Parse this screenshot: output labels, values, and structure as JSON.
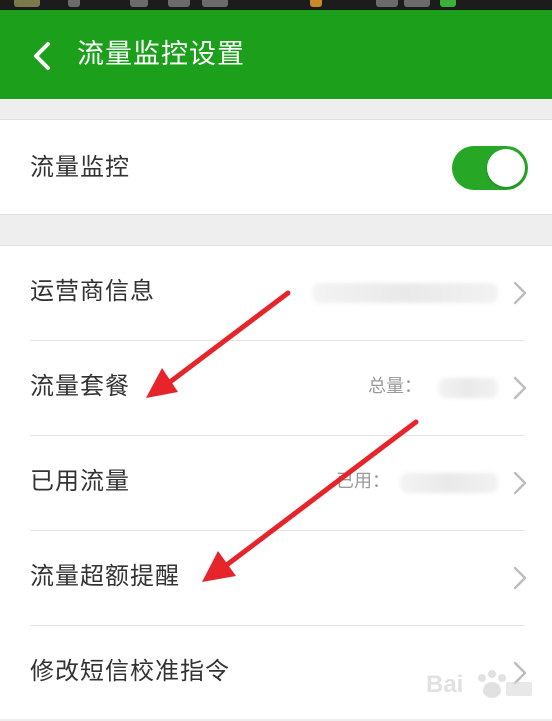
{
  "header": {
    "title": "流量监控设置"
  },
  "monitor": {
    "label": "流量监控",
    "enabled": true
  },
  "settings": {
    "items": [
      {
        "label": "运营商信息",
        "value": ""
      },
      {
        "label": "流量套餐",
        "value": "总量："
      },
      {
        "label": "已用流量",
        "value": "已用："
      },
      {
        "label": "流量超额提醒",
        "value": ""
      },
      {
        "label": "修改短信校准指令",
        "value": ""
      }
    ]
  },
  "annotations": {
    "arrow_color": "#e8242b"
  },
  "watermark": {
    "text": "Bai"
  },
  "colors": {
    "app_bar": "#1ca01c",
    "toggle_on": "#26a826",
    "page_background": "#eeeeee"
  }
}
